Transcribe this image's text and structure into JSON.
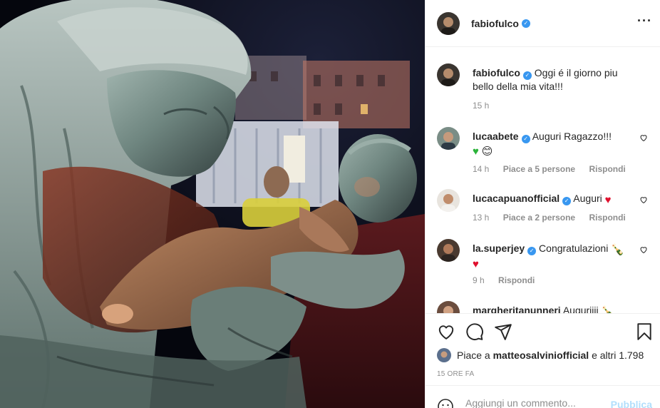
{
  "post": {
    "author": "fabiofulco",
    "more_icon": "more-horizontal-icon"
  },
  "caption": {
    "author": "fabiofulco",
    "text": "Oggi é il giorno piu bello della mia vita!!!",
    "time": "15 h"
  },
  "comments": [
    {
      "user": "lucaabete",
      "text": "Auguri Ragazzo!!!",
      "emoji": "💚 😊",
      "time": "14 h",
      "likes": "Piace a 5 persone",
      "reply": "Rispondi"
    },
    {
      "user": "lucacapuanofficial",
      "text": "Auguri",
      "emoji": "❤",
      "time": "13 h",
      "likes": "Piace a 2 persone",
      "reply": "Rispondi"
    },
    {
      "user": "la.superjey",
      "text": "Congratulazioni",
      "emoji": "🍾 ❤",
      "time": "9 h",
      "reply": "Rispondi"
    },
    {
      "user": "margheritanunneri",
      "text": "Auguriiii",
      "emoji": "🍾"
    }
  ],
  "likes_bar": {
    "prefix": "Piace a",
    "top_liker": "matteosalviniofficial",
    "suffix": "e altri 1.798"
  },
  "time_ago": "15 ORE FA",
  "add_comment": {
    "placeholder": "Aggiungi un commento...",
    "publish": "Pubblica"
  },
  "colors": {
    "verified": "#3897f0",
    "publish_disabled": "#b2dffc",
    "meta_gray": "#8e8e8e"
  }
}
